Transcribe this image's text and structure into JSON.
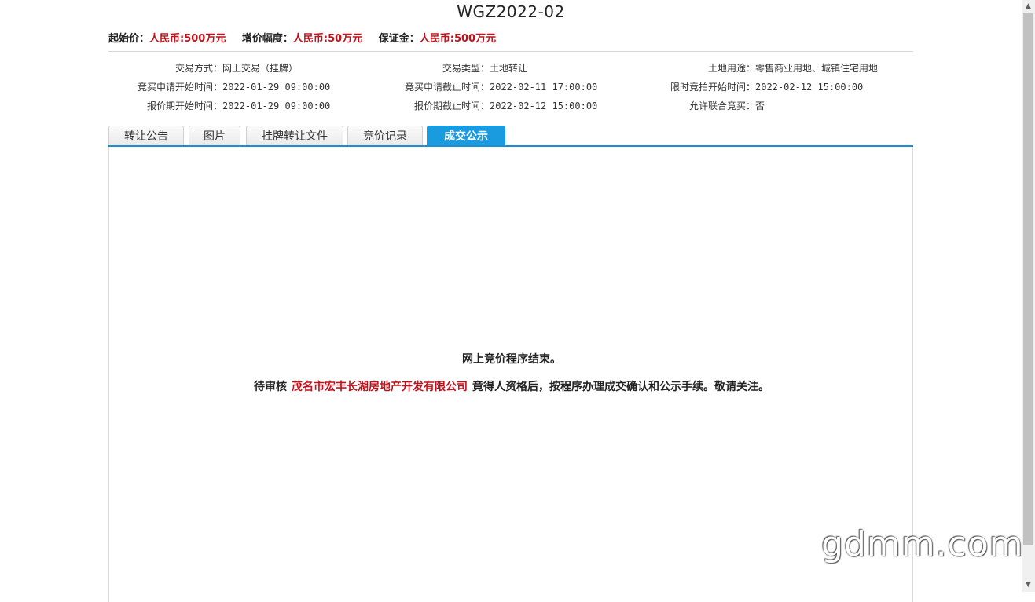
{
  "header": {
    "title": "WGZ2022-02"
  },
  "prices": [
    {
      "label": "起始价：",
      "value": "人民币:500万元"
    },
    {
      "label": "增价幅度：",
      "value": "人民币:50万元"
    },
    {
      "label": "保证金：",
      "value": "人民币:500万元"
    }
  ],
  "info": {
    "rows": [
      [
        {
          "k": "交易方式：",
          "v": "网上交易（挂牌）"
        },
        {
          "k": "交易类型：",
          "v": "土地转让"
        },
        {
          "k": "土地用途：",
          "v": "零售商业用地、城镇住宅用地"
        }
      ],
      [
        {
          "k": "竞买申请开始时间：",
          "v": "2022-01-29 09:00:00"
        },
        {
          "k": "竞买申请截止时间：",
          "v": "2022-02-11 17:00:00"
        },
        {
          "k": "限时竞拍开始时间：",
          "v": "2022-02-12 15:00:00"
        }
      ],
      [
        {
          "k": "报价期开始时间：",
          "v": "2022-01-29 09:00:00"
        },
        {
          "k": "报价期截止时间：",
          "v": "2022-02-12 15:00:00"
        },
        {
          "k": "允许联合竞买：",
          "v": "否"
        }
      ]
    ]
  },
  "tabs": [
    {
      "label": "转让公告"
    },
    {
      "label": "图片"
    },
    {
      "label": "挂牌转让文件"
    },
    {
      "label": "竞价记录"
    },
    {
      "label": "成交公示",
      "active": true
    }
  ],
  "notice": {
    "line1": "网上竞价程序结束。",
    "prefix": "待审核",
    "company": "茂名市宏丰长湖房地产开发有限公司",
    "suffix": "竟得人资格后，按程序办理成交确认和公示手续。敬请关注。"
  },
  "watermark": "gdmm.com",
  "colors": {
    "accent": "#1a9be0",
    "price_red": "#c0121b"
  }
}
